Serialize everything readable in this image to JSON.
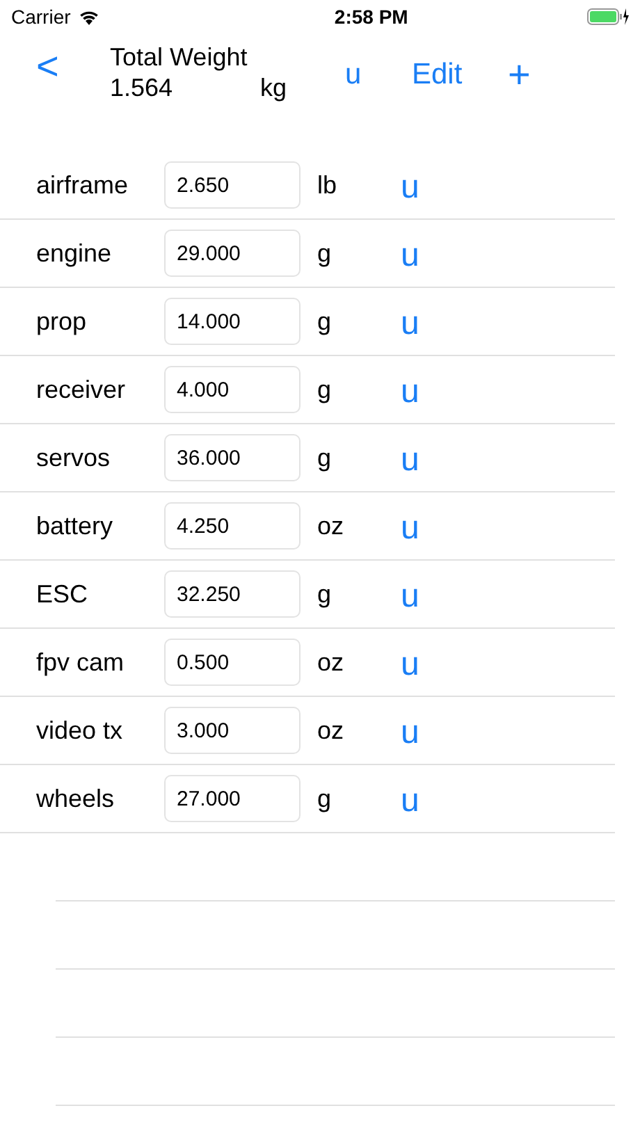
{
  "status_bar": {
    "carrier": "Carrier",
    "time": "2:58 PM"
  },
  "nav": {
    "back": "<",
    "title": "Total Weight",
    "total": "1.564",
    "total_unit": "kg",
    "units_button": "u",
    "edit": "Edit",
    "add": "+"
  },
  "rows": [
    {
      "name": "airframe",
      "value": "2.650",
      "unit": "lb",
      "units_button": "u"
    },
    {
      "name": "engine",
      "value": "29.000",
      "unit": "g",
      "units_button": "u"
    },
    {
      "name": "prop",
      "value": "14.000",
      "unit": "g",
      "units_button": "u"
    },
    {
      "name": "receiver",
      "value": "4.000",
      "unit": "g",
      "units_button": "u"
    },
    {
      "name": "servos",
      "value": "36.000",
      "unit": "g",
      "units_button": "u"
    },
    {
      "name": "battery",
      "value": "4.250",
      "unit": "oz",
      "units_button": "u"
    },
    {
      "name": "ESC",
      "value": "32.250",
      "unit": "g",
      "units_button": "u"
    },
    {
      "name": "fpv cam",
      "value": "0.500",
      "unit": "oz",
      "units_button": "u"
    },
    {
      "name": "video tx",
      "value": "3.000",
      "unit": "oz",
      "units_button": "u"
    },
    {
      "name": "wheels",
      "value": "27.000",
      "unit": "g",
      "units_button": "u"
    }
  ]
}
